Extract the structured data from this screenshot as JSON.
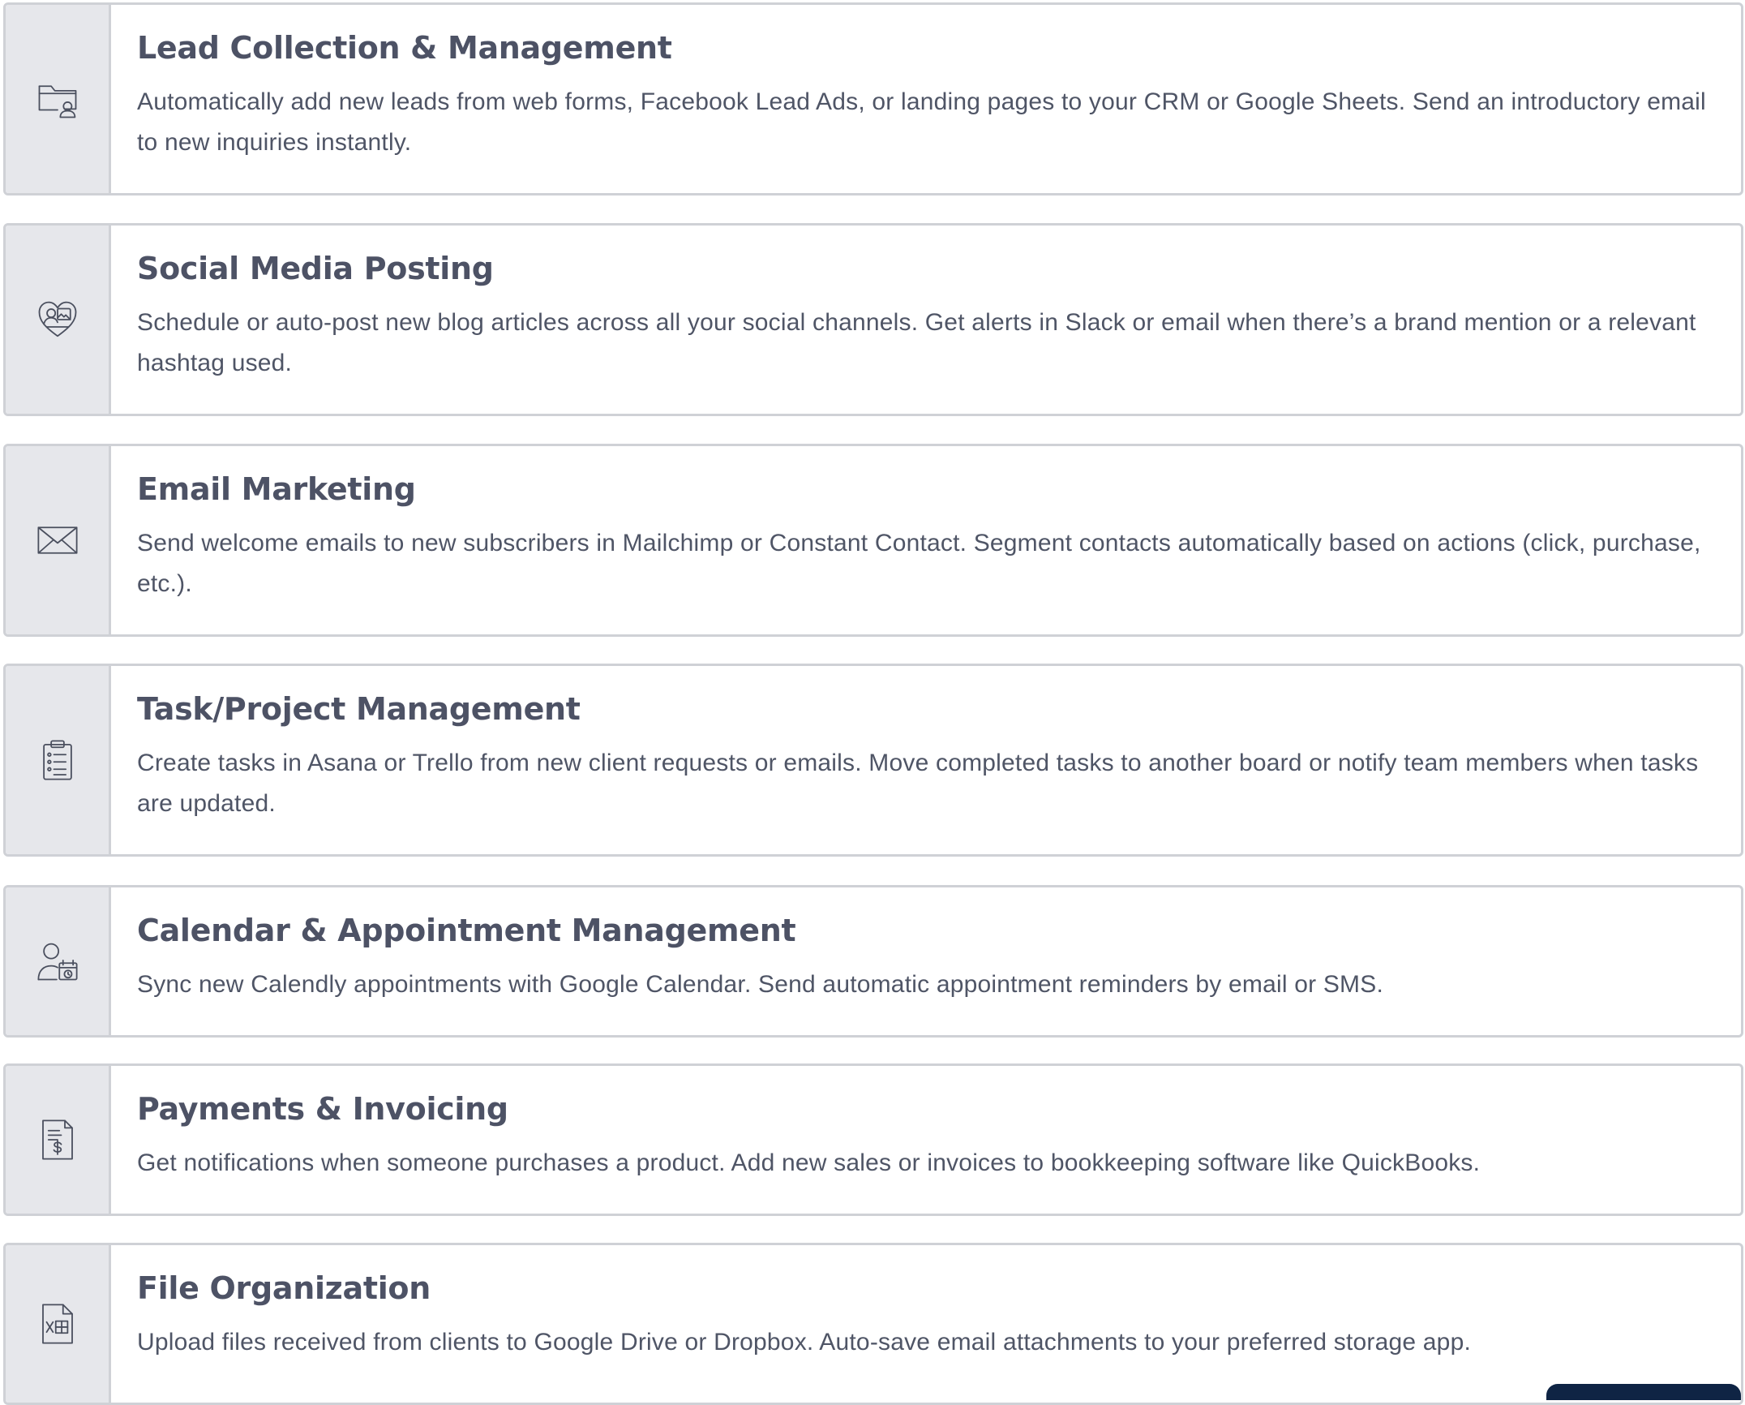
{
  "cards": [
    {
      "icon": "folder-user-icon",
      "title": "Lead Collection & Management",
      "description": "Automatically add new leads from web forms, Facebook Lead Ads, or landing pages to your CRM or Google Sheets. Send an introductory email to new inquiries instantly."
    },
    {
      "icon": "heart-image-icon",
      "title": "Social Media Posting",
      "description": "Schedule or auto-post new blog articles across all your social channels. Get alerts in Slack or email when there’s a brand mention or a relevant hashtag used."
    },
    {
      "icon": "envelope-icon",
      "title": "Email Marketing",
      "description": "Send welcome emails to new subscribers in Mailchimp or Constant Contact. Segment contacts automatically based on actions (click, purchase, etc.)."
    },
    {
      "icon": "clipboard-list-icon",
      "title": "Task/Project Management",
      "description": "Create tasks in Asana or Trello from new client requests or emails. Move completed tasks to another board or notify team members when tasks are updated."
    },
    {
      "icon": "user-calendar-icon",
      "title": "Calendar & Appointment Management",
      "description": "Sync new Calendly appointments with Google Calendar. Send automatic appointment reminders by email or SMS."
    },
    {
      "icon": "invoice-dollar-icon",
      "title": "Payments & Invoicing",
      "description": "Get notifications when someone purchases a product. Add new sales or invoices to bookkeeping software like QuickBooks."
    },
    {
      "icon": "spreadsheet-file-icon",
      "title": "File Organization",
      "description": "Upload files received from clients to Google Drive or Dropbox. Auto-save email attachments to your preferred storage app."
    }
  ],
  "colors": {
    "border": "#cfd1d6",
    "icon_bg": "#e6e7eb",
    "text": "#4d5265",
    "corner_accent": "#0f2444"
  }
}
